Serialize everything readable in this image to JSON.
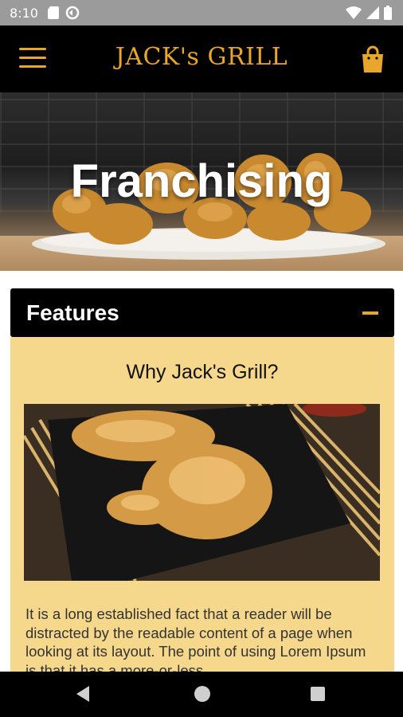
{
  "status_bar": {
    "time": "8:10",
    "icons": [
      "sd-card-icon",
      "sync-icon",
      "wifi-icon",
      "signal-icon",
      "battery-icon"
    ]
  },
  "app_bar": {
    "logo_text": "JACK's GRILL",
    "menu_icon": "hamburger-menu-icon",
    "cart_icon": "shopping-bag-icon",
    "accent": "#e8a72a"
  },
  "hero": {
    "title": "Franchising"
  },
  "section": {
    "title": "Features",
    "toggle_icon": "minus-icon",
    "heading": "Why Jack's Grill?",
    "body": "It is a long established fact that a reader will be distracted by the readable content of a page when looking at its layout. The point of using Lorem Ipsum is that it has a more-or-less",
    "panel_color": "#f5d88c"
  },
  "nav_bar": {
    "back": "back-icon",
    "home": "home-icon",
    "recent": "recent-apps-icon"
  }
}
